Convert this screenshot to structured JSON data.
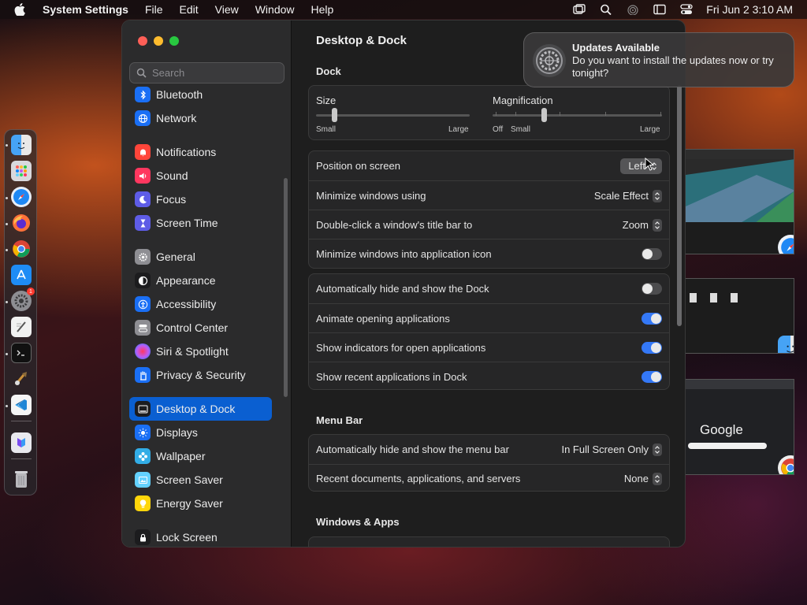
{
  "menubar": {
    "app": "System Settings",
    "items": [
      "File",
      "Edit",
      "View",
      "Window",
      "Help"
    ],
    "clock": "Fri Jun 2  3:10 AM"
  },
  "dock": {
    "apps": [
      "Finder",
      "Launchpad",
      "Safari",
      "Firefox",
      "Chrome",
      "App Store",
      "System Settings",
      "TextEdit",
      "Terminal",
      "Instruments",
      "VS Code",
      "Xcode Project",
      "Trash"
    ],
    "settings_badge": "1"
  },
  "sidebar": {
    "search_placeholder": "Search",
    "items": [
      {
        "label": "Bluetooth",
        "color": "#1a6ff5"
      },
      {
        "label": "Network",
        "color": "#1a6ff5"
      },
      {
        "label": "Notifications",
        "color": "#ff453a"
      },
      {
        "label": "Sound",
        "color": "#ff375f"
      },
      {
        "label": "Focus",
        "color": "#5e5ce6"
      },
      {
        "label": "Screen Time",
        "color": "#5e5ce6"
      },
      {
        "label": "General",
        "color": "#8e8e93"
      },
      {
        "label": "Appearance",
        "color": "#1c1c1e"
      },
      {
        "label": "Accessibility",
        "color": "#1a6ff5"
      },
      {
        "label": "Control Center",
        "color": "#8e8e93"
      },
      {
        "label": "Siri & Spotlight",
        "color": "#bf5af2"
      },
      {
        "label": "Privacy & Security",
        "color": "#1a6ff5"
      },
      {
        "label": "Desktop & Dock",
        "color": "#1c1c1e"
      },
      {
        "label": "Displays",
        "color": "#1a6ff5"
      },
      {
        "label": "Wallpaper",
        "color": "#32ade6"
      },
      {
        "label": "Screen Saver",
        "color": "#64d2ff"
      },
      {
        "label": "Energy Saver",
        "color": "#ffd60a"
      },
      {
        "label": "Lock Screen",
        "color": "#1c1c1e"
      }
    ],
    "active": "Desktop & Dock"
  },
  "content": {
    "title": "Desktop & Dock",
    "dock_section": "Dock",
    "size": {
      "label": "Size",
      "min_label": "Small",
      "max_label": "Large",
      "value": 0.12
    },
    "magnification": {
      "label": "Magnification",
      "off_label": "Off",
      "min_label": "Small",
      "max_label": "Large",
      "value": 0.3
    },
    "position": {
      "label": "Position on screen",
      "value": "Left"
    },
    "minimize_using": {
      "label": "Minimize windows using",
      "value": "Scale Effect"
    },
    "double_click": {
      "label": "Double-click a window's title bar to",
      "value": "Zoom"
    },
    "minimize_into_icon": {
      "label": "Minimize windows into application icon",
      "on": false
    },
    "auto_hide_dock": {
      "label": "Automatically hide and show the Dock",
      "on": false
    },
    "animate": {
      "label": "Animate opening applications",
      "on": true
    },
    "indicators": {
      "label": "Show indicators for open applications",
      "on": true
    },
    "recent_apps": {
      "label": "Show recent applications in Dock",
      "on": true
    },
    "menubar_section": "Menu Bar",
    "auto_hide_menubar": {
      "label": "Automatically hide and show the menu bar",
      "value": "In Full Screen Only"
    },
    "recent_docs": {
      "label": "Recent documents, applications, and servers",
      "value": "None"
    },
    "windows_section": "Windows & Apps"
  },
  "notification": {
    "title": "Updates Available",
    "body": "Do you want to install the updates now or try tonight?"
  },
  "thumbnails": {
    "google": "Google"
  }
}
